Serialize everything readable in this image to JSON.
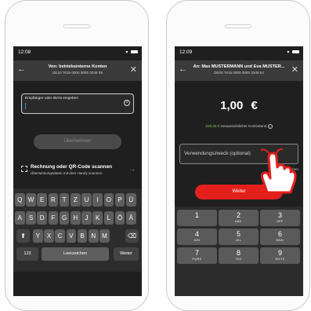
{
  "left": {
    "status_time": "12:08",
    "header_title": "Von: betriebsinterne Konten",
    "header_iban": "DE10 7015 0000 0000 3249 39",
    "iban_placeholder": "Empfänger oder IBAN eingeben",
    "submit_label": "Übernehmen",
    "scan_title": "Rechnung oder QR-Code scannen",
    "scan_subtitle": "Überweisungsdaten mit dem Handy scannen",
    "keyboard": {
      "row1": [
        "Q",
        "W",
        "E",
        "R",
        "T",
        "Z",
        "U",
        "I",
        "O",
        "P",
        "Ü"
      ],
      "row2": [
        "A",
        "S",
        "D",
        "F",
        "G",
        "H",
        "J",
        "K",
        "L",
        "Ö",
        "Ä"
      ],
      "row3": [
        "Y",
        "X",
        "C",
        "V",
        "B",
        "N",
        "M"
      ],
      "numbers_key": "123",
      "space_key": "Leerzeichen",
      "return_key": "Weiter"
    }
  },
  "right": {
    "status_time": "12:09",
    "header_title": "An: Max MUSTERMANN und Eva MUSTER...",
    "header_iban": "DE00 7015 0000 0000 3249 54",
    "amount_value": "1,00",
    "currency": "€",
    "balance_amount": "310,33 €",
    "balance_text": "voraussichtlicher Kontostand",
    "purpose_placeholder": "Verwendungszweck (optional)",
    "chars_remaining": "Noch 140 Zeichen",
    "continue_label": "Weiter",
    "numpad": [
      {
        "d": "1",
        "l": ""
      },
      {
        "d": "2",
        "l": "ABC"
      },
      {
        "d": "3",
        "l": "DEF"
      },
      {
        "d": "4",
        "l": "GHI"
      },
      {
        "d": "5",
        "l": "JKL"
      },
      {
        "d": "6",
        "l": "MNO"
      },
      {
        "d": "7",
        "l": "PQRS"
      },
      {
        "d": "8",
        "l": "TUV"
      },
      {
        "d": "9",
        "l": "WXYZ"
      }
    ]
  },
  "colors": {
    "accent_red": "#e3201c",
    "balance_green": "#8bd05a",
    "cursor_blue": "#2f8fe0"
  }
}
